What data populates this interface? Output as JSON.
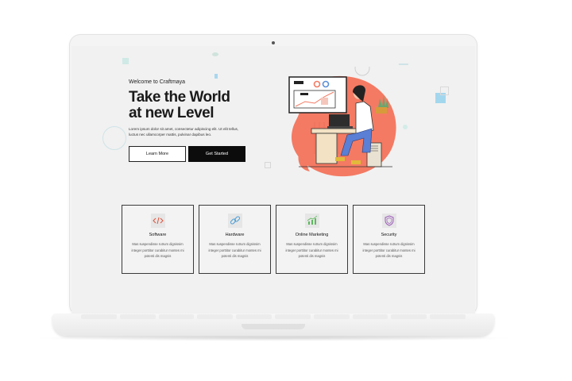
{
  "hero": {
    "welcome": "Welcome to Craftmaya",
    "title_line1": "Take the World",
    "title_line2": "at new Level",
    "description": "Lorem ipsum dolor sit amet, consectetur adipiscing elit. Ut elit tellus, luctus nec ullamcorper mattis, pulvinar dapibus leo.",
    "learn_more": "Learn More",
    "get_started": "Get Started"
  },
  "cards": [
    {
      "title": "Software",
      "icon": "code-icon",
      "desc": "Mas suspendisse rutrum dignissim integer porttitor curabitur montes mi potenti dis magnis"
    },
    {
      "title": "Hardware",
      "icon": "link-icon",
      "desc": "Mas suspendisse rutrum dignissim integer porttitor curabitur montes mi potenti dis magnis"
    },
    {
      "title": "Online Marketing",
      "icon": "chart-icon",
      "desc": "Mas suspendisse rutrum dignissim integer porttitor curabitur montes mi potenti dis magnis"
    },
    {
      "title": "Security",
      "icon": "shield-icon",
      "desc": "Mas suspendisse rutrum dignissim integer porttitor curabitur montes mi potenti dis magnis"
    }
  ],
  "colors": {
    "accent": "#f47a63",
    "dark_button": "#0c0c0c",
    "card_icon_bg": "#e6e6e6"
  }
}
